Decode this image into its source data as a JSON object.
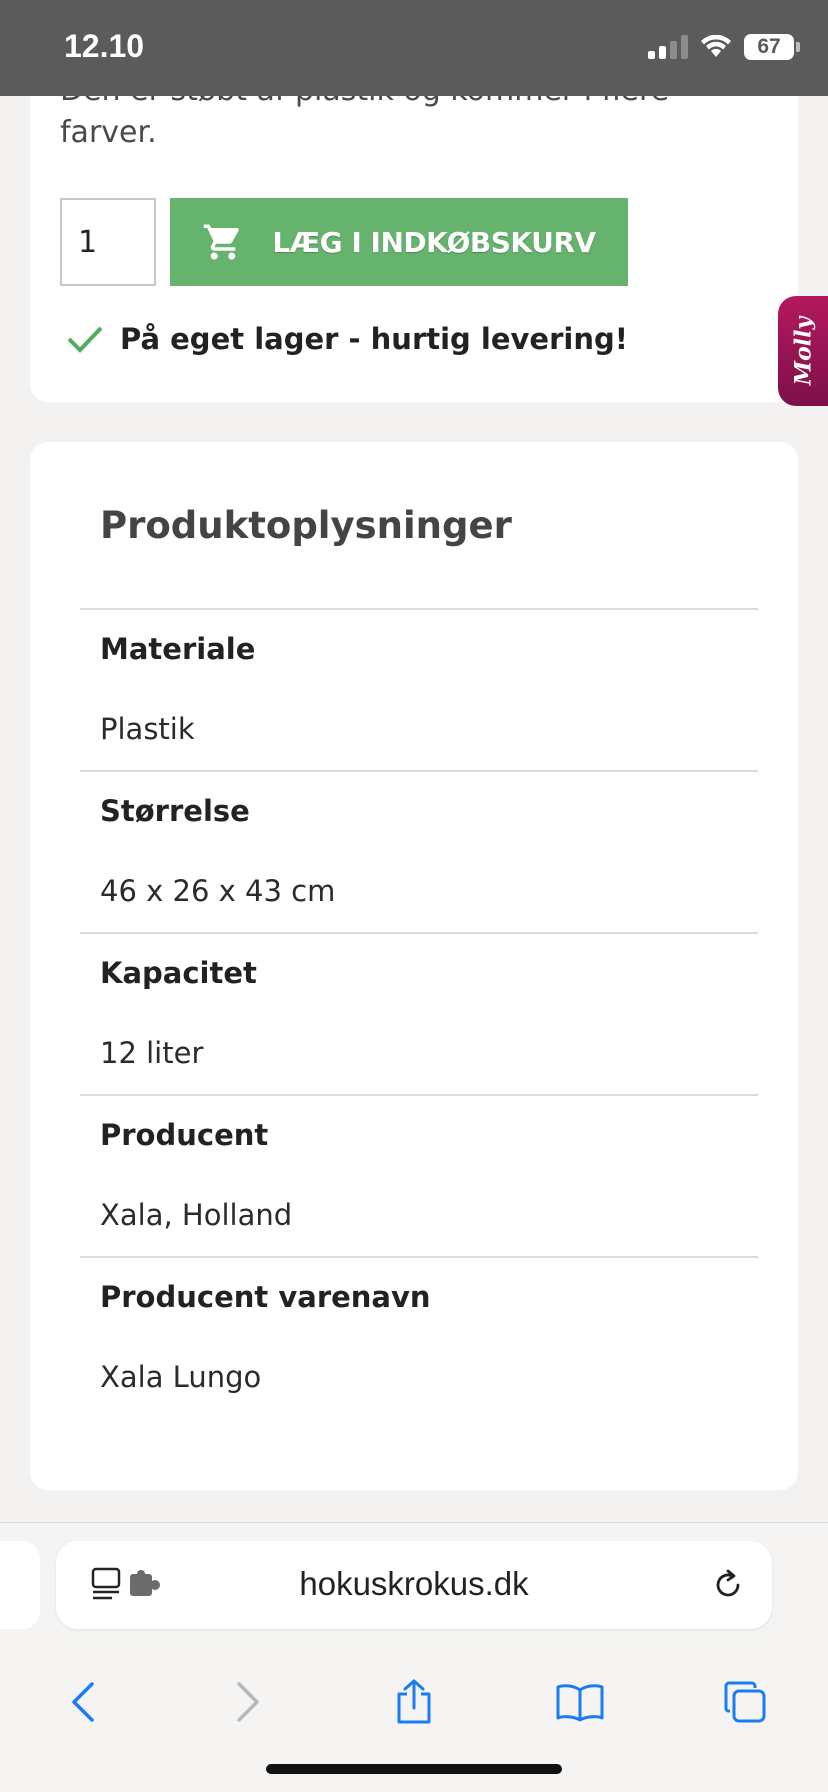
{
  "status": {
    "time": "12.10",
    "battery": "67"
  },
  "product": {
    "description_cut": "Den er støbt af plastik og kommer i flere farver.",
    "quantity": "1",
    "add_to_cart": "LÆG I INDKØBSKURV",
    "stock_text": "På eget lager - hurtig levering!"
  },
  "molly": {
    "label": "Molly"
  },
  "info": {
    "title": "Produktoplysninger",
    "specs": [
      {
        "label": "Materiale",
        "value": "Plastik"
      },
      {
        "label": "Størrelse",
        "value": "46 x 26 x 43 cm"
      },
      {
        "label": "Kapacitet",
        "value": "12 liter"
      },
      {
        "label": "Producent",
        "value": "Xala, Holland"
      },
      {
        "label": "Producent varenavn",
        "value": "Xala Lungo"
      }
    ]
  },
  "browser": {
    "url": "hokuskrokus.dk"
  },
  "colors": {
    "accent_green": "#66b36e",
    "molly": "#b5185e",
    "ios_blue": "#1a7cf0"
  }
}
